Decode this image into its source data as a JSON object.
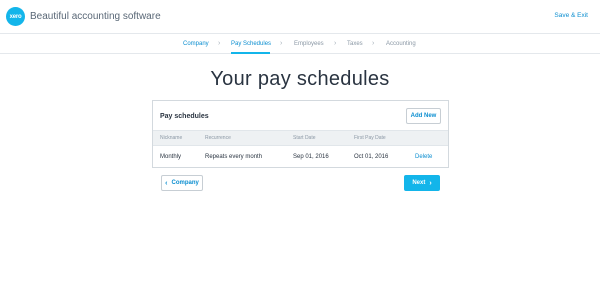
{
  "header": {
    "logo_text": "xero",
    "app_title": "Beautiful accounting software",
    "save_exit": "Save & Exit"
  },
  "steps": [
    {
      "label": "Company",
      "state": "done"
    },
    {
      "label": "Pay Schedules",
      "state": "active"
    },
    {
      "label": "Employees",
      "state": "pending"
    },
    {
      "label": "Taxes",
      "state": "pending"
    },
    {
      "label": "Accounting",
      "state": "pending"
    }
  ],
  "page_title": "Your pay schedules",
  "panel": {
    "title": "Pay schedules",
    "add_new": "Add New",
    "columns": [
      "Nickname",
      "Recurrence",
      "Start Date",
      "First Pay Date"
    ],
    "rows": [
      {
        "nickname": "Monthly",
        "recurrence": "Repeats every month",
        "start_date": "Sep 01, 2016",
        "first_pay_date": "Oct 01, 2016",
        "action": "Delete"
      }
    ]
  },
  "nav": {
    "back_label": "Company",
    "next_label": "Next",
    "back_icon": "chevron-left-icon",
    "next_icon": "chevron-right-icon"
  },
  "colors": {
    "accent": "#13b5ea",
    "link": "#0b8ed0",
    "text": "#2a3441"
  }
}
